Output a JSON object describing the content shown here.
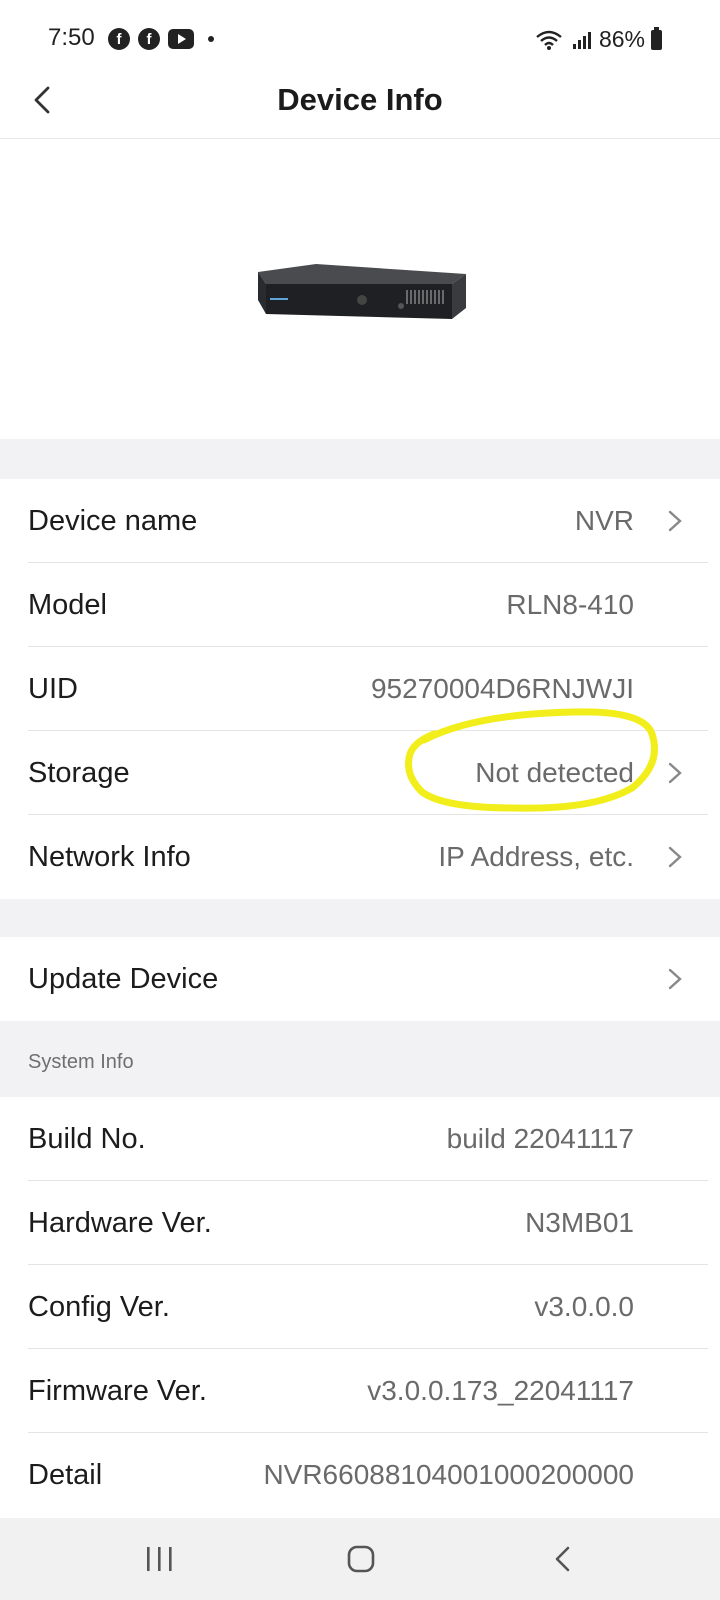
{
  "status_bar": {
    "time": "7:50",
    "app_icons": [
      "facebook-icon",
      "facebook-icon",
      "youtube-icon"
    ],
    "battery": "86%"
  },
  "header": {
    "title": "Device Info"
  },
  "device_rows": [
    {
      "label": "Device name",
      "value": "NVR",
      "chevron": true
    },
    {
      "label": "Model",
      "value": "RLN8-410",
      "chevron": false
    },
    {
      "label": "UID",
      "value": "95270004D6RNJWJI",
      "chevron": false
    },
    {
      "label": "Storage",
      "value": "Not detected",
      "chevron": true
    },
    {
      "label": "Network Info",
      "value": "IP Address, etc.",
      "chevron": true
    }
  ],
  "update": {
    "label": "Update Device"
  },
  "system_info": {
    "section_label": "System Info",
    "rows": [
      {
        "label": "Build No.",
        "value": "build 22041117"
      },
      {
        "label": "Hardware Ver.",
        "value": "N3MB01"
      },
      {
        "label": "Config Ver.",
        "value": "v3.0.0.0"
      },
      {
        "label": "Firmware Ver.",
        "value": "v3.0.0.173_22041117"
      },
      {
        "label": "Detail",
        "value": "NVR660881040010002​00000"
      }
    ]
  },
  "colors": {
    "highlight": "#f2ee1c",
    "section_bg": "#f2f2f4"
  }
}
